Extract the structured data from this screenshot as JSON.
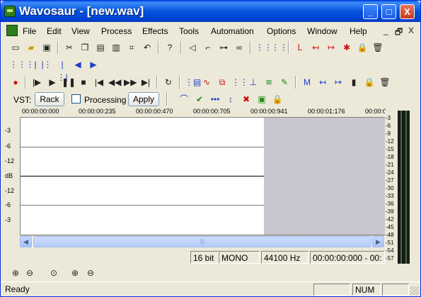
{
  "window": {
    "title": "Wavosaur - [new.wav]",
    "minimize": "_",
    "maximize": "□",
    "close": "X"
  },
  "menu": {
    "items": [
      "File",
      "Edit",
      "View",
      "Process",
      "Effects",
      "Tools",
      "Automation",
      "Options",
      "Window",
      "Help"
    ],
    "mdi_minimize": "_",
    "mdi_restore": "🗗",
    "mdi_close": "X"
  },
  "vst": {
    "label": "VST:",
    "rack_button": "Rack",
    "processing_label": "Processing",
    "apply_button": "Apply"
  },
  "ruler": {
    "ticks": [
      "00:00:00:000",
      "00:00:00:235",
      "00:00:00:470",
      "00:00:00:705",
      "00:00:00:941",
      "00:00:01:176",
      "00:00:0"
    ]
  },
  "left_scale": [
    "-3",
    "-6",
    "-12",
    "dB",
    "-12",
    "-6",
    "-3"
  ],
  "right_scale": [
    "-3",
    "-6",
    "-9",
    "-12",
    "-15",
    "-18",
    "-21",
    "-24",
    "-27",
    "-30",
    "-33",
    "-36",
    "-39",
    "-42",
    "-45",
    "-48",
    "-51",
    "-54",
    "-57"
  ],
  "info": {
    "bits": "16 bit",
    "channels": "MONO",
    "rate": "44100 Hz",
    "time": "00:00:00:000 - 00:"
  },
  "status": {
    "ready": "Ready",
    "num": "NUM"
  },
  "colors": {
    "titlebar": "#0453dd",
    "wave_bg": "#ffffff",
    "gray_region": "#c9c6cf",
    "chrome": "#ece9d8"
  }
}
